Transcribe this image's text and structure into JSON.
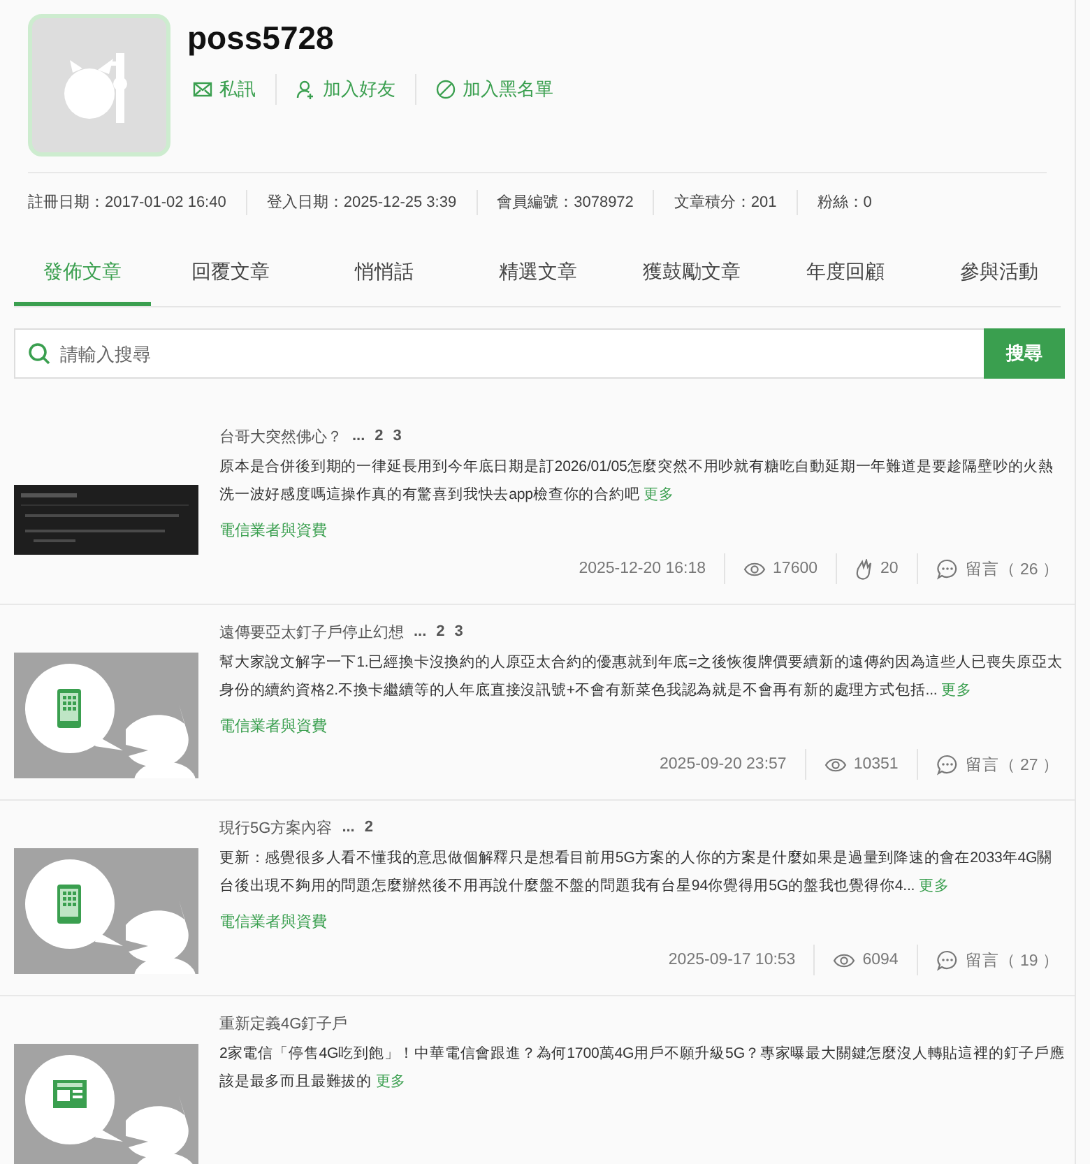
{
  "profile": {
    "username": "poss5728",
    "actions": [
      {
        "kind": "message",
        "label": "私訊"
      },
      {
        "kind": "friend",
        "label": "加入好友"
      },
      {
        "kind": "block",
        "label": "加入黑名單"
      }
    ],
    "stats": [
      "註冊日期：2017-01-02 16:40",
      "登入日期：2025-12-25 3:39",
      "會員編號：3078972",
      "文章積分：201",
      "粉絲：0"
    ]
  },
  "tabs": [
    {
      "label": "發佈文章",
      "selected": true
    },
    {
      "label": "回覆文章",
      "selected": false
    },
    {
      "label": "悄悄話",
      "selected": false
    },
    {
      "label": "精選文章",
      "selected": false
    },
    {
      "label": "獲鼓勵文章",
      "selected": false
    },
    {
      "label": "年度回顧",
      "selected": false
    },
    {
      "label": "參與活動",
      "selected": false
    }
  ],
  "search": {
    "placeholder": "請輸入搜尋",
    "button": "搜尋"
  },
  "posts": [
    {
      "thumbnail": {
        "kind": "picture"
      },
      "title": "台哥大突然佛心？",
      "pages": [
        "...",
        "2",
        "3"
      ],
      "body": "原本是合併後到期的一律延長用到今年底日期是訂2026/01/05怎麼突然不用吵就有糖吃自動延期一年難道是要趁隔壁吵的火熱洗一波好感度嗎這操作真的有驚喜到我快去app檢查你的合約吧",
      "more": "更多",
      "category": "電信業者與資費",
      "date": "2025-12-20 16:18",
      "views": "17600",
      "likes": "20",
      "comments": "留言（ 26 ）"
    },
    {
      "thumbnail": {
        "kind": "phone"
      },
      "title": "遠傳要亞太釘子戶停止幻想",
      "pages": [
        "...",
        "2",
        "3"
      ],
      "body": "幫大家說文解字一下1.已經換卡沒換約的人原亞太合約的優惠就到年底=之後恢復牌價要續新的遠傳約因為這些人已喪失原亞太身份的續約資格2.不換卡繼續等的人年底直接沒訊號+不會有新菜色我認為就是不會再有新的處理方式包括...",
      "more": "更多",
      "category": "電信業者與資費",
      "date": "2025-09-20 23:57",
      "views": "10351",
      "comments": "留言（ 27 ）"
    },
    {
      "thumbnail": {
        "kind": "phone"
      },
      "title": "現行5G方案內容",
      "pages": [
        "...",
        "2"
      ],
      "body": "更新：感覺很多人看不懂我的意思做個解釋只是想看目前用5G方案的人你的方案是什麼如果是過量到降速的會在2033年4G關台後出現不夠用的問題怎麼辦然後不用再說什麼盤不盤的問題我有台星94你覺得用5G的盤我也覺得你4...",
      "more": "更多",
      "category": "電信業者與資費",
      "date": "2025-09-17 10:53",
      "views": "6094",
      "comments": "留言（ 19 ）"
    },
    {
      "thumbnail": {
        "kind": "news"
      },
      "title": "重新定義4G釘子戶",
      "body": "2家電信「停售4G吃到飽」！中華電信會跟進？為何1700萬4G用戶不願升級5G？專家曝最大關鍵怎麼沒人轉貼這裡的釘子戶應該是最多而且最難拔的",
      "more": "更多"
    }
  ]
}
